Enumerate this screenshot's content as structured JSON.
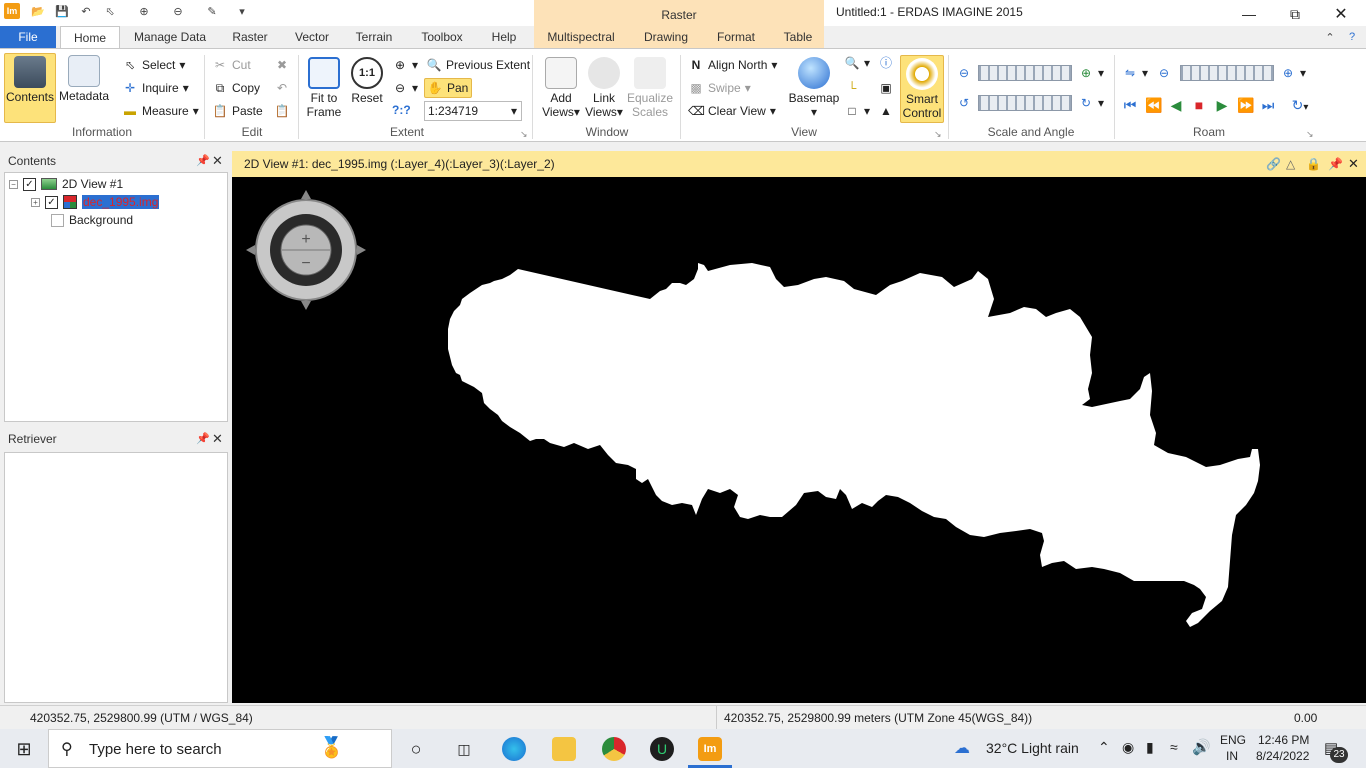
{
  "titlebar": {
    "context_tab": "Raster",
    "window_title": "Untitled:1 - ERDAS IMAGINE 2015",
    "app_logo": "Im"
  },
  "tabs": [
    "File",
    "Home",
    "Manage Data",
    "Raster",
    "Vector",
    "Terrain",
    "Toolbox",
    "Help",
    "Multispectral",
    "Drawing",
    "Format",
    "Table"
  ],
  "ribbon": {
    "information": {
      "label": "Information",
      "contents": "Contents",
      "metadata": "Metadata",
      "select": "Select",
      "inquire": "Inquire",
      "measure": "Measure"
    },
    "edit": {
      "label": "Edit",
      "cut": "Cut",
      "copy": "Copy",
      "paste": "Paste"
    },
    "extent": {
      "label": "Extent",
      "fit_line1": "Fit to",
      "fit_line2": "Frame",
      "reset": "Reset",
      "previous_extent": "Previous Extent",
      "pan": "Pan",
      "unknown_scale": "?:?",
      "scale_value": "1:234719"
    },
    "window": {
      "label": "Window",
      "add_line1": "Add",
      "add_line2": "Views",
      "link_line1": "Link",
      "link_line2": "Views",
      "equalize_line1": "Equalize",
      "equalize_line2": "Scales"
    },
    "view": {
      "label": "View",
      "align_north": "Align North",
      "swipe": "Swipe",
      "clear_view": "Clear View",
      "basemap": "Basemap",
      "smart_line1": "Smart",
      "smart_line2": "Control"
    },
    "scale_angle": {
      "label": "Scale and Angle"
    },
    "roam": {
      "label": "Roam"
    }
  },
  "contents_panel": {
    "title": "Contents",
    "view_node": "2D View #1",
    "layer_node": "dec_1995.img",
    "background_node": "Background"
  },
  "retriever_panel": {
    "title": "Retriever"
  },
  "view": {
    "title": "2D View #1: dec_1995.img (:Layer_4)(:Layer_3)(:Layer_2)"
  },
  "statusbar": {
    "left": "420352.75, 2529800.99  (UTM / WGS_84)",
    "middle": "420352.75, 2529800.99 meters (UTM Zone 45(WGS_84))",
    "right": "0.00"
  },
  "taskbar": {
    "search_placeholder": "Type here to search",
    "weather": "32°C  Light rain",
    "lang_line1": "ENG",
    "lang_line2": "IN",
    "time": "12:46 PM",
    "date": "8/24/2022",
    "notifications": "23"
  }
}
